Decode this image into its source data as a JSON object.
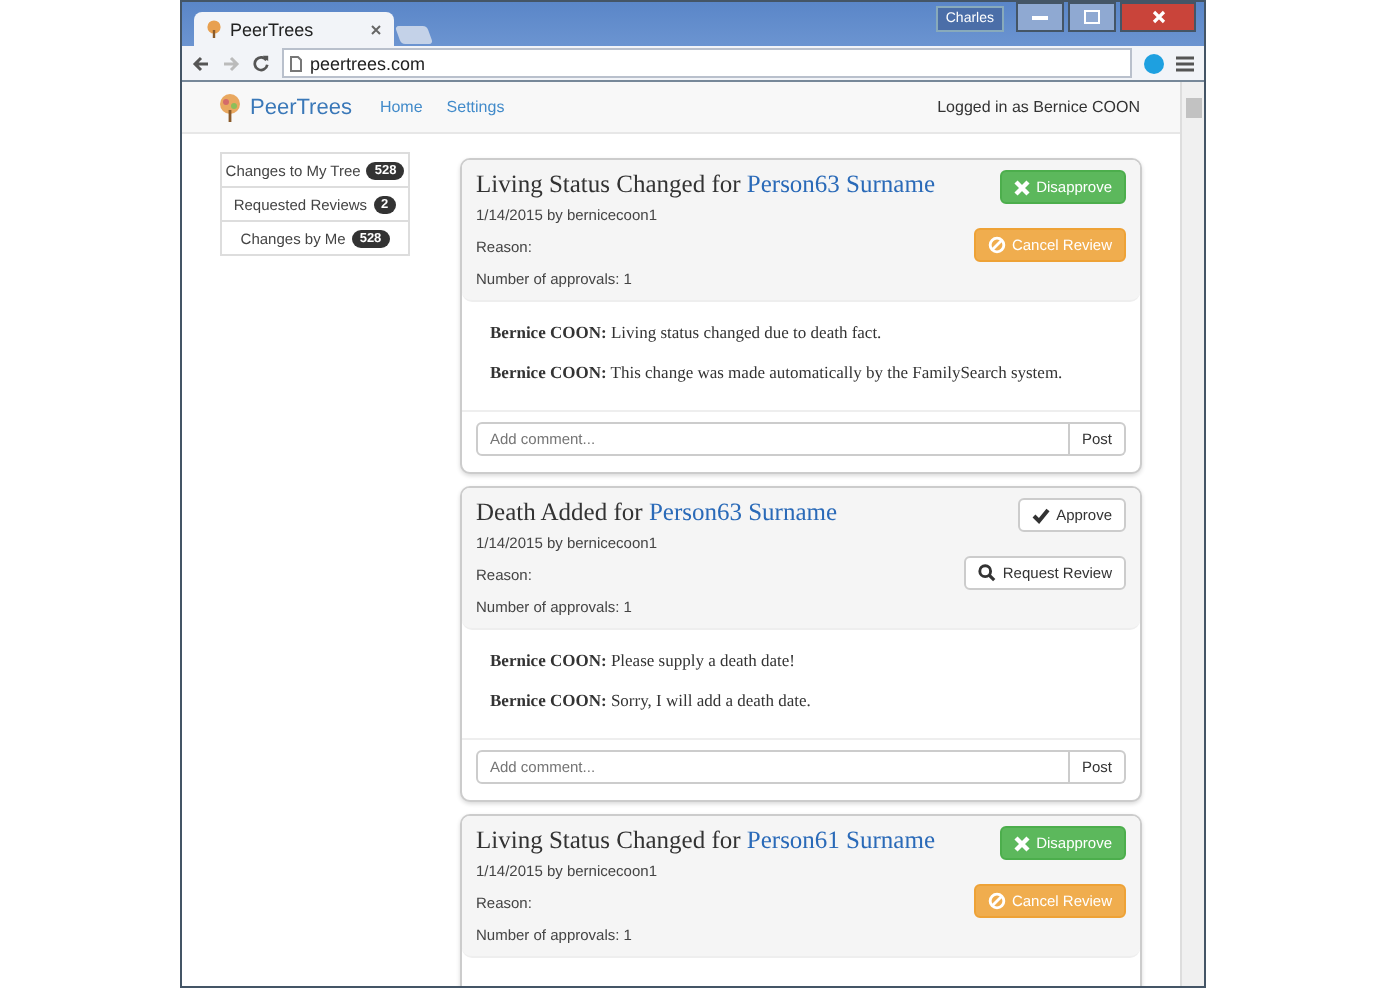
{
  "browser": {
    "tab_title": "PeerTrees",
    "user": "Charles",
    "url": "peertrees.com"
  },
  "navbar": {
    "brand": "PeerTrees",
    "links": [
      "Home",
      "Settings"
    ],
    "status": "Logged in as Bernice COON"
  },
  "sidebar": {
    "items": [
      {
        "label": "Changes to My Tree",
        "count": "528"
      },
      {
        "label": "Requested Reviews",
        "count": "2"
      },
      {
        "label": "Changes by Me",
        "count": "528"
      }
    ]
  },
  "cards": [
    {
      "title": "Living Status Changed for ",
      "person": "Person63 Surname",
      "meta": "1/14/2015 by bernicecoon1",
      "reason": "Reason:",
      "approvals": "Number of approvals: 1",
      "buttons": [
        {
          "kind": "disapprove",
          "label": "Disapprove"
        },
        {
          "kind": "cancel",
          "label": "Cancel Review"
        }
      ],
      "comments": [
        "**Bernice COON:** Living status changed due to death fact.",
        "**Bernice COON:** This change was made automatically by the FamilySearch system."
      ],
      "comment_field": {
        "placeholder": "Add comment...",
        "button": "Post"
      }
    },
    {
      "title": "Death Added for ",
      "person": "Person63 Surname",
      "meta": "1/14/2015 by bernicecoon1",
      "reason": "Reason:",
      "approvals": "Number of approvals: 1",
      "buttons": [
        {
          "kind": "approve",
          "label": "Approve"
        },
        {
          "kind": "request",
          "label": "Request Review"
        }
      ],
      "comments": [
        "**Bernice COON:** Please supply a death date!",
        "**Bernice COON:** Sorry, I will add a death date."
      ],
      "comment_field": {
        "placeholder": "Add comment...",
        "button": "Post"
      }
    },
    {
      "title": "Living Status Changed for ",
      "person": "Person61 Surname",
      "meta": "1/14/2015 by bernicecoon1",
      "reason": "Reason:",
      "approvals": "Number of approvals: 1",
      "buttons": [
        {
          "kind": "disapprove",
          "label": "Disapprove"
        },
        {
          "kind": "cancel",
          "label": "Cancel Review"
        }
      ]
    }
  ]
}
